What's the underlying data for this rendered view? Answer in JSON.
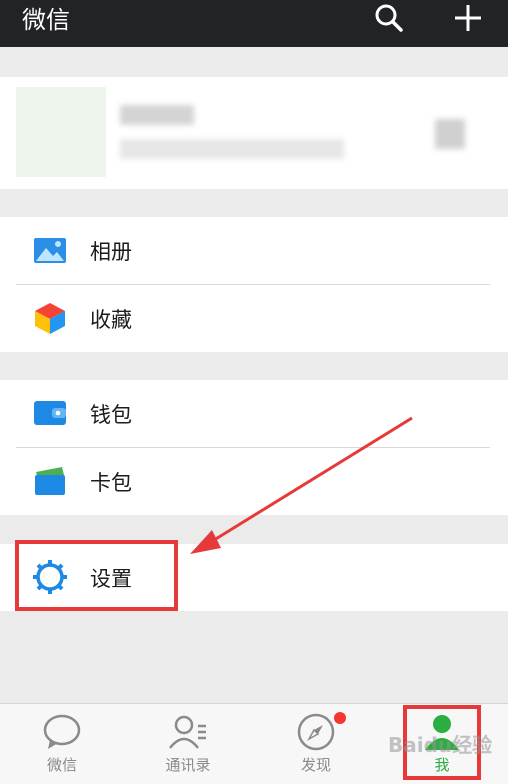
{
  "header": {
    "title": "微信"
  },
  "menu": {
    "album": "相册",
    "favorites": "收藏",
    "wallet": "钱包",
    "cards": "卡包",
    "settings": "设置"
  },
  "tabs": [
    {
      "label": "微信"
    },
    {
      "label": "通讯录"
    },
    {
      "label": "发现"
    },
    {
      "label": "我"
    }
  ],
  "watermark": "Baidu经验",
  "colors": {
    "accent_green": "#2aae3f",
    "highlight_red": "#e63a3a",
    "icon_blue": "#2196f3",
    "topbar": "#222326"
  }
}
